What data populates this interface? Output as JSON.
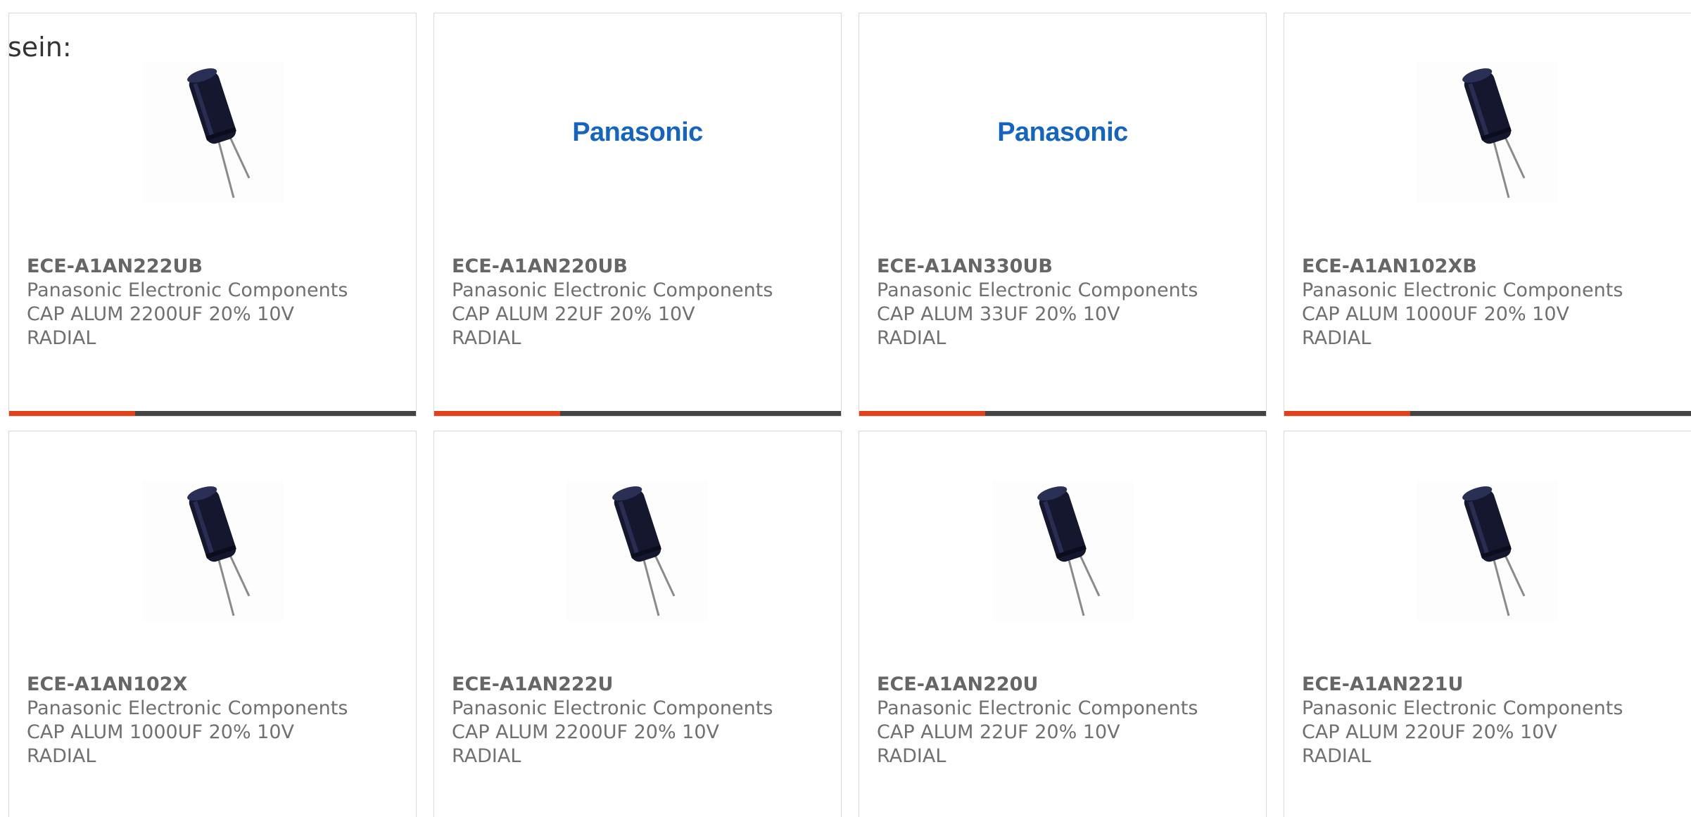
{
  "intro_text": "sein:",
  "products": [
    {
      "part": "ECE-A1AN222UB",
      "maker": "Panasonic Electronic Components",
      "desc1": "CAP ALUM 2200UF 20% 10V",
      "desc2": "RADIAL",
      "image": "capacitor-image",
      "progress": 0.31
    },
    {
      "part": "ECE-A1AN220UB",
      "maker": "Panasonic Electronic Components",
      "desc1": "CAP ALUM 22UF 20% 10V",
      "desc2": "RADIAL",
      "image": "panasonic-logo",
      "logo_text": "Panasonic",
      "progress": 0.31
    },
    {
      "part": "ECE-A1AN330UB",
      "maker": "Panasonic Electronic Components",
      "desc1": "CAP ALUM 33UF 20% 10V",
      "desc2": "RADIAL",
      "image": "panasonic-logo",
      "logo_text": "Panasonic",
      "progress": 0.31
    },
    {
      "part": "ECE-A1AN102XB",
      "maker": "Panasonic Electronic Components",
      "desc1": "CAP ALUM 1000UF 20% 10V",
      "desc2": "RADIAL",
      "image": "capacitor-image",
      "progress": 0.31
    },
    {
      "part": "ECE-A1AN102X",
      "maker": "Panasonic Electronic Components",
      "desc1": "CAP ALUM 1000UF 20% 10V",
      "desc2": "RADIAL",
      "image": "capacitor-image"
    },
    {
      "part": "ECE-A1AN222U",
      "maker": "Panasonic Electronic Components",
      "desc1": "CAP ALUM 2200UF 20% 10V",
      "desc2": "RADIAL",
      "image": "capacitor-image"
    },
    {
      "part": "ECE-A1AN220U",
      "maker": "Panasonic Electronic Components",
      "desc1": "CAP ALUM 22UF 20% 10V",
      "desc2": "RADIAL",
      "image": "capacitor-image"
    },
    {
      "part": "ECE-A1AN221U",
      "maker": "Panasonic Electronic Components",
      "desc1": "CAP ALUM 220UF 20% 10V",
      "desc2": "RADIAL",
      "image": "capacitor-image"
    }
  ],
  "colors": {
    "accent": "#e4411a",
    "bar_track": "#444444",
    "logo": "#1565c0"
  }
}
